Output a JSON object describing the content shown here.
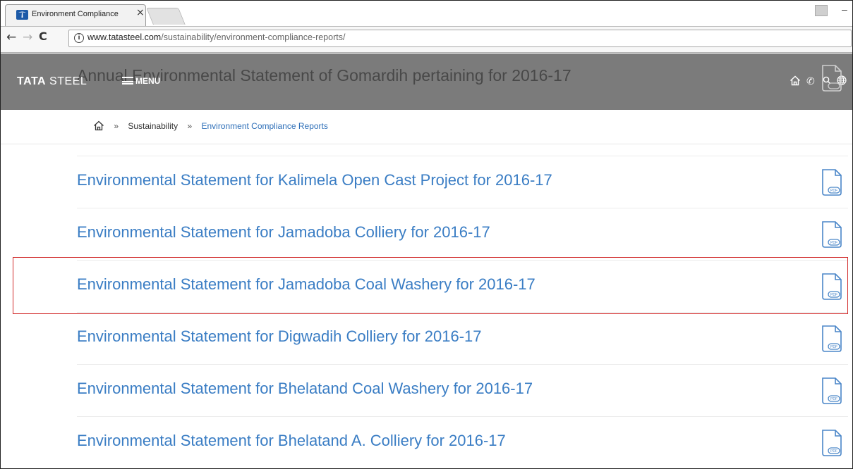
{
  "browser": {
    "tab_title": "Environment Compliance",
    "tab_close": "×",
    "url_domain": "www.tatasteel.com",
    "url_path": "/sustainability/environment-compliance-reports/",
    "nav_back": "←",
    "nav_forward": "→",
    "nav_reload": "C",
    "info_glyph": "i",
    "minimize": "–"
  },
  "header": {
    "brand_bold": "TATA",
    "brand_light": " STEEL",
    "menu_label": "MENU",
    "overlay_title": "Annual Environmental Statement of Gomardih pertaining for 2016-17",
    "phone_glyph": "✆",
    "colors": {
      "bar": "#7b7b7b",
      "text": "#ffffff"
    }
  },
  "breadcrumb": {
    "separator": "»",
    "items": [
      "Sustainability",
      "Environment Compliance Reports"
    ]
  },
  "reports": [
    {
      "title": "Environmental Statement for Kalimela Open Cast Project for 2016-17",
      "icon": "pdf-icon"
    },
    {
      "title": "Environmental Statement for Jamadoba Colliery for 2016-17",
      "icon": "pdf-icon"
    },
    {
      "title": "Environmental Statement for Jamadoba Coal Washery for 2016-17",
      "icon": "pdf-icon",
      "highlighted": true
    },
    {
      "title": "Environmental Statement for Digwadih Colliery for 2016-17",
      "icon": "pdf-icon"
    },
    {
      "title": "Environmental Statement for Bhelatand Coal Washery for 2016-17",
      "icon": "pdf-icon"
    },
    {
      "title": "Environmental Statement for Bhelatand A. Colliery for 2016-17",
      "icon": "pdf-icon"
    }
  ],
  "pdf_label": "PDF",
  "colors": {
    "link": "#3a7dc4",
    "highlight": "#d12a2a"
  }
}
